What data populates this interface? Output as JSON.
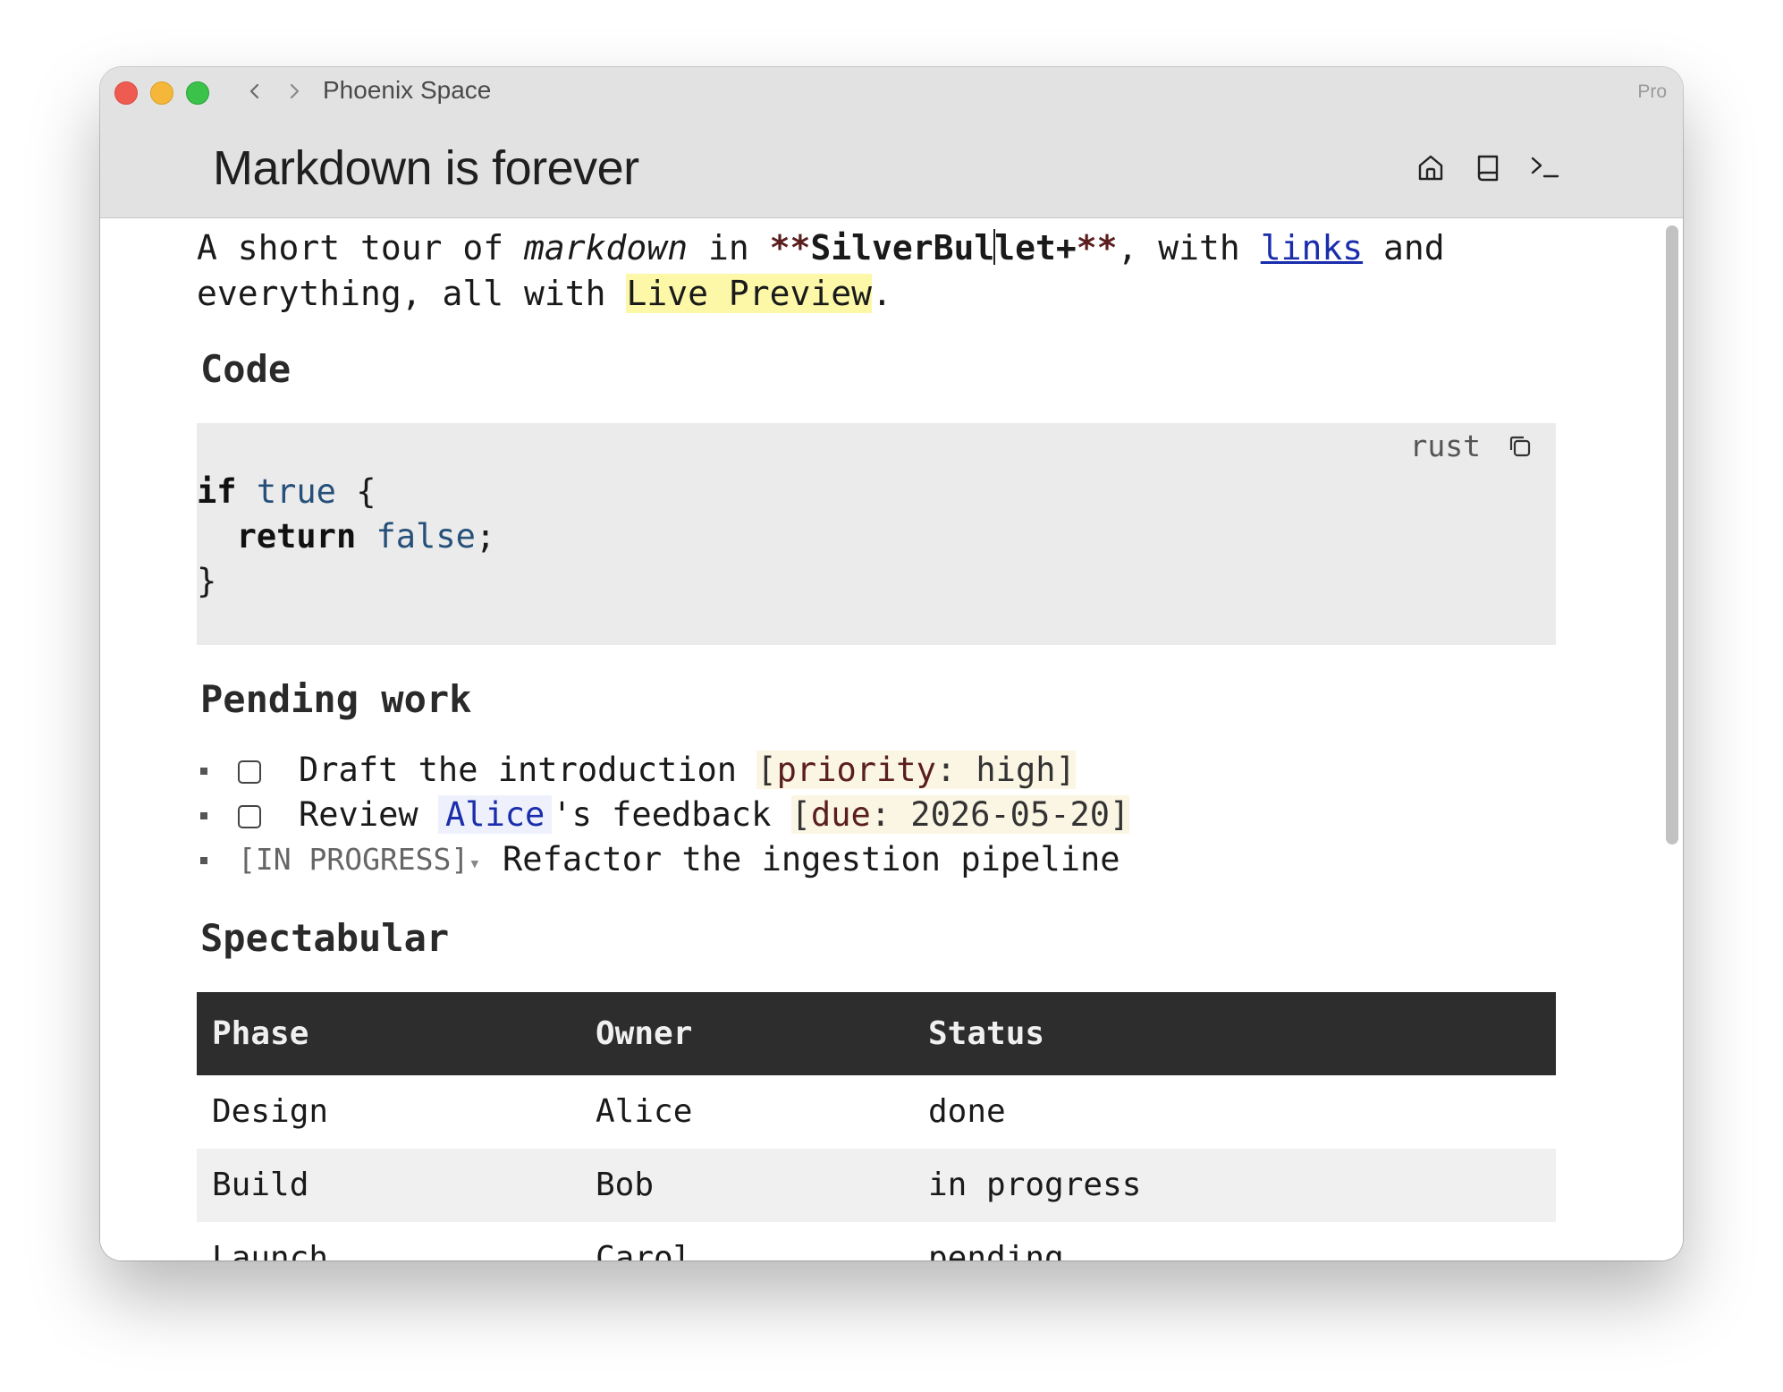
{
  "window": {
    "space_name": "Phoenix Space",
    "plan_badge": "Pro",
    "page_title": "Markdown is forever",
    "toolbar_icons": [
      "home-icon",
      "book-icon",
      "terminal-icon"
    ]
  },
  "intro": {
    "t1": "A short tour of ",
    "italic": "markdown",
    "t2": " in ",
    "md_open": "**",
    "bold_a": "SilverBul",
    "bold_b": "let+",
    "md_close": "**",
    "t3": ", with ",
    "link": "links",
    "t4": " and everything, all with ",
    "highlight": "Live Preview",
    "t5": "."
  },
  "code_section": {
    "heading": "Code",
    "language": "rust",
    "line1_kw": "if",
    "line1_lit": "true",
    "line1_rest": " {",
    "line2_indent": "  ",
    "line2_kw": "return",
    "line2_lit": "false",
    "line2_rest": ";",
    "line3": "}"
  },
  "pending": {
    "heading": "Pending work",
    "tasks": [
      {
        "text": "Draft the introduction ",
        "attr_open": "[",
        "attr_key": "priority",
        "attr_value": ": high]"
      },
      {
        "pre": "Review ",
        "mention": "Alice",
        "post": "'s feedback ",
        "attr_open": "[",
        "attr_key": "due",
        "attr_value": ": 2026-05-20]"
      },
      {
        "state": "[IN PROGRESS]",
        "caret": "▾",
        "text": "Refactor the ingestion pipeline"
      }
    ]
  },
  "table": {
    "heading": "Spectabular",
    "columns": [
      "Phase",
      "Owner",
      "Status"
    ],
    "rows": [
      [
        "Design",
        "Alice",
        "done"
      ],
      [
        "Build",
        "Bob",
        "in progress"
      ],
      [
        "Launch",
        "Carol",
        "pending"
      ]
    ]
  },
  "colors": {
    "link": "#1a2dab",
    "highlight": "#fcf8a8",
    "table_header_bg": "#2d2d2d",
    "code_bg": "#ebebeb"
  }
}
